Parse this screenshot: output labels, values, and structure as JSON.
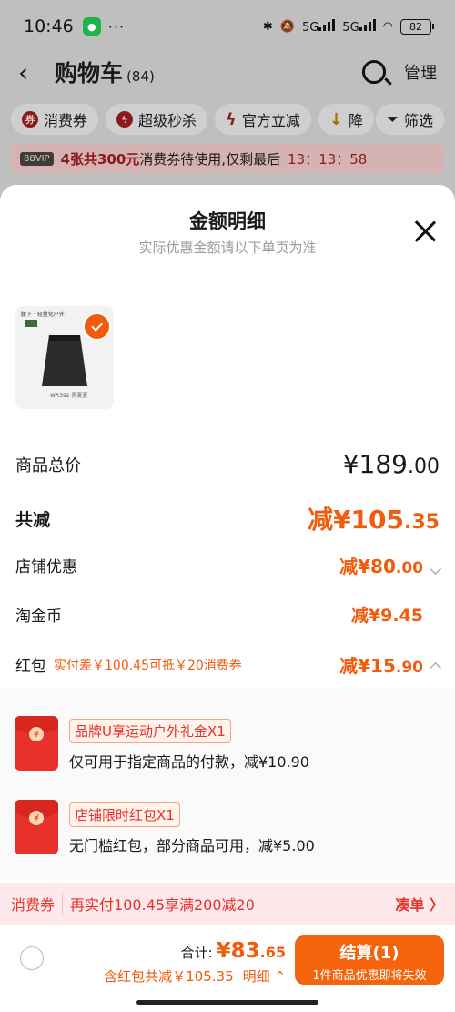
{
  "status_bar": {
    "time": "10:46",
    "more": "···",
    "network_a": "5G",
    "network_b": "5G",
    "battery": "82"
  },
  "header": {
    "title": "购物车",
    "count": "(84)",
    "manage": "管理"
  },
  "filters": [
    {
      "label": "消费券"
    },
    {
      "label": "超级秒杀"
    },
    {
      "label": "官方立减"
    },
    {
      "label": "降"
    }
  ],
  "filter_button": "筛选",
  "promo": {
    "vip": "88VIP",
    "highlight": "4张共300元",
    "text": "消费券待使用,仅剩最后",
    "countdown": "13：13：58"
  },
  "sheet": {
    "title": "金额明细",
    "subtitle": "实际优惠金额请以下单页为准"
  },
  "product": {
    "brand_text": "腰下 · 轻量化户外",
    "tag": "Ren",
    "caption": "WR392 黑夏夏"
  },
  "summary": {
    "total_label": "商品总价",
    "total_int": "¥189",
    "total_dec": ".00",
    "reduce_label": "共减",
    "reduce_int": "减¥105",
    "reduce_dec": ".35",
    "shop_label": "店铺优惠",
    "shop_int": "减¥80",
    "shop_dec": ".00",
    "coin_label": "淘金币",
    "coin_val": "减¥9.45",
    "red_label": "红包",
    "red_sub": "实付差￥100.45可抵￥20消费券",
    "red_int": "减¥15",
    "red_dec": ".90"
  },
  "red_packets": [
    {
      "coin": "¥",
      "tag": "品牌U享运动户外礼金X1",
      "desc": "仅可用于指定商品的付款，减¥10.90"
    },
    {
      "coin": "¥",
      "tag": "店铺限时红包X1",
      "desc": "无门槛红包，部分商品可用，减¥5.00"
    }
  ],
  "coupon_bar": {
    "label": "消费券",
    "message": "再实付100.45享满200减20",
    "action": "凑单 〉"
  },
  "footer": {
    "total_label": "合计:",
    "total_int": "¥83",
    "total_dec": ".65",
    "saved": "含红包共减￥105.35",
    "detail": "明细",
    "pay_label": "结算(1)",
    "pay_sub": "1件商品优惠即将失效"
  }
}
